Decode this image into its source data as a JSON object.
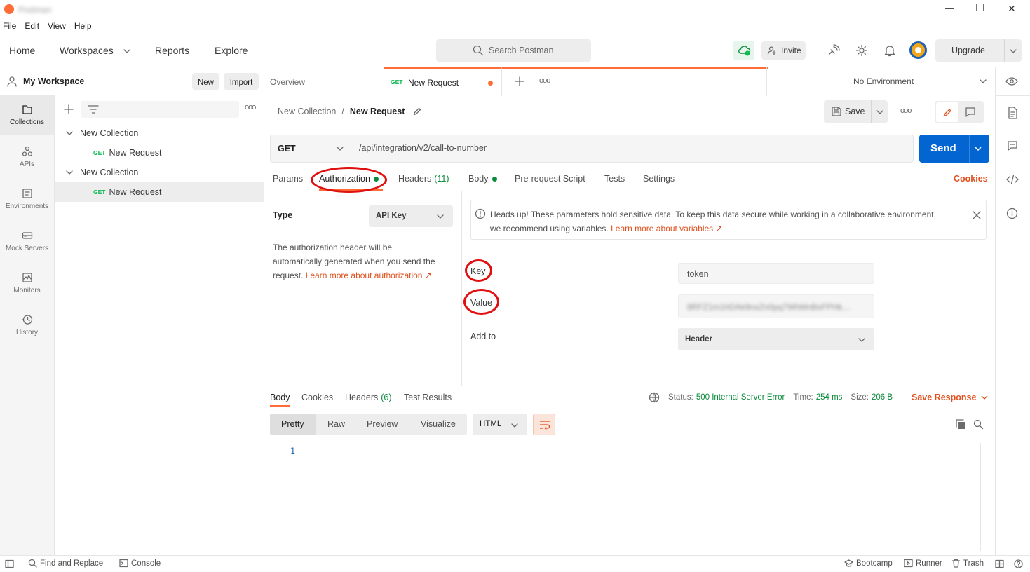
{
  "app": {
    "title": "Postman"
  },
  "window_controls": {
    "minimize": "—",
    "maximize": "☐",
    "close": "✕"
  },
  "menu": [
    "File",
    "Edit",
    "View",
    "Help"
  ],
  "header": {
    "nav": {
      "home": "Home",
      "workspaces": "Workspaces",
      "reports": "Reports",
      "explore": "Explore"
    },
    "search_placeholder": "Search Postman",
    "invite": "Invite",
    "upgrade": "Upgrade"
  },
  "workspace": {
    "name": "My Workspace",
    "new": "New",
    "import": "Import"
  },
  "rail": {
    "collections": "Collections",
    "apis": "APIs",
    "environments": "Environments",
    "mock_servers": "Mock Servers",
    "monitors": "Monitors",
    "history": "History"
  },
  "tree": {
    "items": [
      {
        "label": "New Collection",
        "method": ""
      },
      {
        "label": "New Request",
        "method": "GET"
      },
      {
        "label": "New Collection",
        "method": ""
      },
      {
        "label": "New Request",
        "method": "GET"
      }
    ]
  },
  "tabs": {
    "overview": "Overview",
    "active_method": "GET",
    "active_label": "New Request",
    "environment": "No Environment"
  },
  "breadcrumb": {
    "collection": "New Collection",
    "separator": "/",
    "request": "New Request"
  },
  "toolbar": {
    "save": "Save"
  },
  "request": {
    "method": "GET",
    "url": "/api/integration/v2/call-to-number",
    "send": "Send"
  },
  "request_tabs": {
    "params": "Params",
    "authorization": "Authorization",
    "headers": "Headers",
    "headers_count": "(11)",
    "body": "Body",
    "prerequest": "Pre-request Script",
    "tests": "Tests",
    "settings": "Settings",
    "cookies": "Cookies"
  },
  "auth": {
    "type_label": "Type",
    "type_value": "API Key",
    "desc_line1": "The authorization header will be",
    "desc_line2": "automatically generated when you send the",
    "desc_line3": "request.",
    "desc_link": "Learn more about authorization ↗",
    "notice_line1": "Heads up! These parameters hold sensitive data. To keep this data secure while working in a collaborative environment,",
    "notice_line2": "we recommend using variables.",
    "notice_link": "Learn more about variables ↗",
    "key_label": "Key",
    "key_value": "token",
    "value_label": "Value",
    "value_value": "8RFZ1m1hDAk9nxZn0pq7WhMnBxFPHk…",
    "addto_label": "Add to",
    "addto_value": "Header"
  },
  "response": {
    "tabs": {
      "body": "Body",
      "cookies": "Cookies",
      "headers": "Headers",
      "headers_count": "(6)",
      "test_results": "Test Results"
    },
    "status_label": "Status:",
    "status_value": "500 Internal Server Error",
    "time_label": "Time:",
    "time_value": "254 ms",
    "size_label": "Size:",
    "size_value": "206 B",
    "save_response": "Save Response",
    "views": {
      "pretty": "Pretty",
      "raw": "Raw",
      "preview": "Preview",
      "visualize": "Visualize"
    },
    "format": "HTML",
    "line_number": "1"
  },
  "footer": {
    "find_replace": "Find and Replace",
    "console": "Console",
    "bootcamp": "Bootcamp",
    "runner": "Runner",
    "trash": "Trash"
  },
  "colors": {
    "accent": "#ff6c37",
    "send_blue": "#0265d2",
    "link_orange": "#e0511f",
    "annotation_red": "#e01010",
    "status_green": "#0a8a3c"
  }
}
